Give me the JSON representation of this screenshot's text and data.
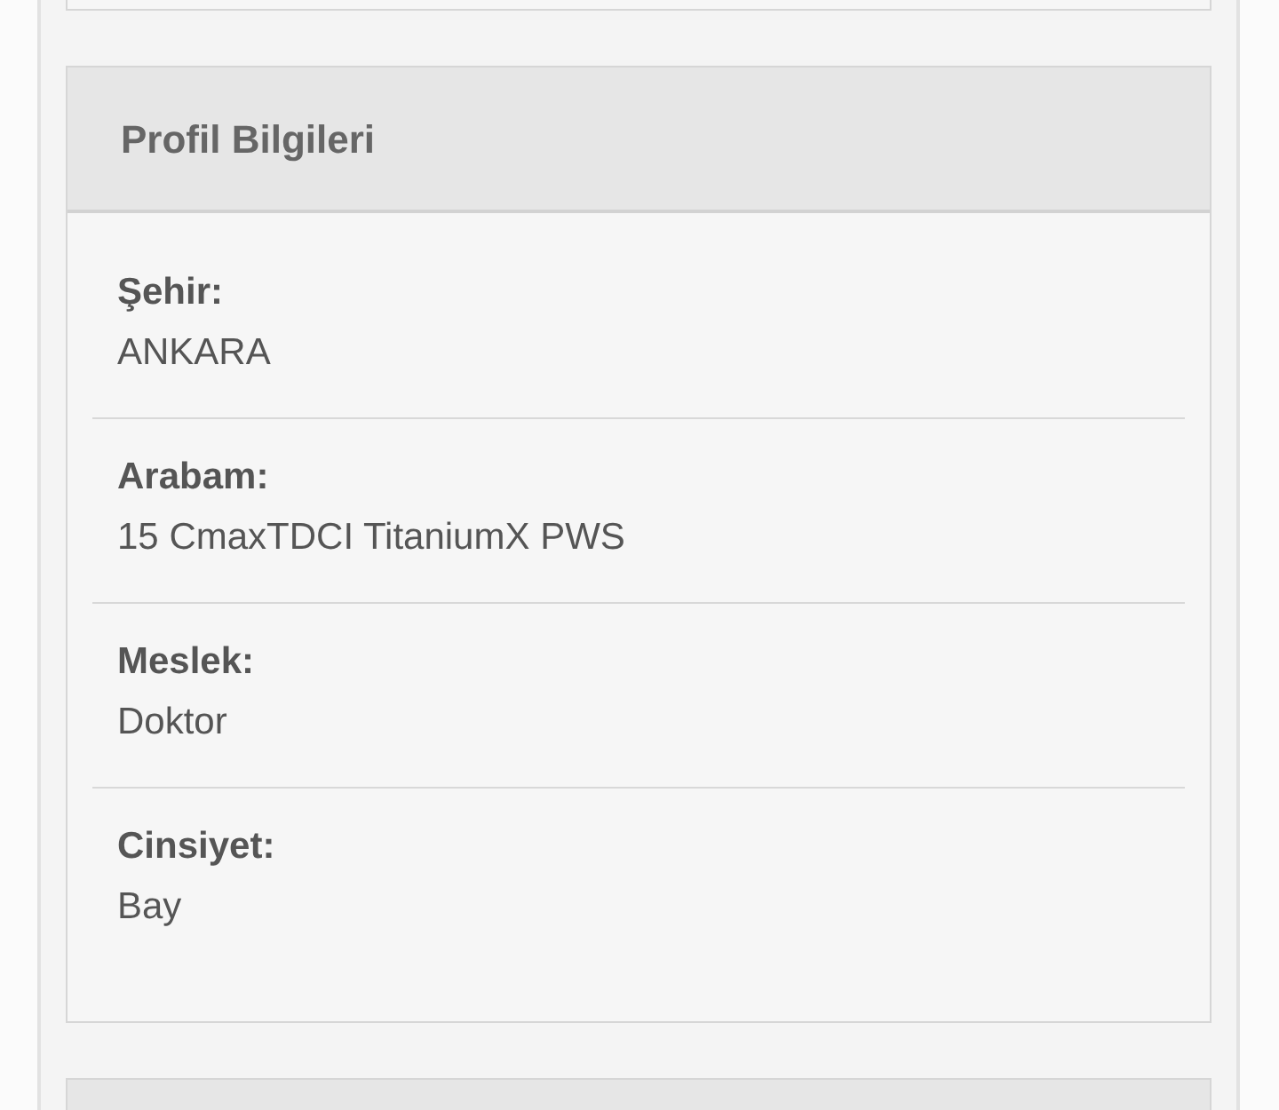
{
  "panel": {
    "title": "Profil Bilgileri",
    "fields": [
      {
        "label": "Şehir:",
        "value": "ANKARA"
      },
      {
        "label": "Arabam:",
        "value": "15 CmaxTDCI TitaniumX PWS"
      },
      {
        "label": "Meslek:",
        "value": "Doktor"
      },
      {
        "label": "Cinsiyet:",
        "value": "Bay"
      }
    ]
  }
}
